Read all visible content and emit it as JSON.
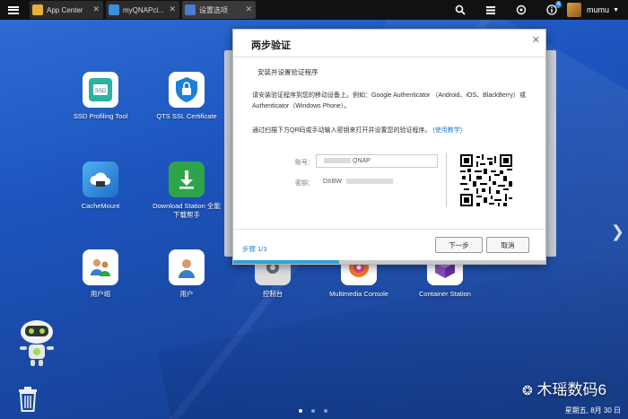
{
  "taskbar": {
    "tabs": [
      {
        "label": "App Center",
        "color": "#e8b038"
      },
      {
        "label": "myQNAPcl...",
        "color": "#3a8fe0"
      },
      {
        "label": "设置选项",
        "color": "#4a7bd0"
      }
    ],
    "notification_count": "4",
    "username": "mumu",
    "icons": [
      "search-icon",
      "tasks-icon",
      "sync-icon",
      "info-icon"
    ]
  },
  "desktop_apps": [
    {
      "label": "SSD Profiling Tool",
      "icon": "ssd-icon",
      "color": "#2bb3a0"
    },
    {
      "label": "QTS SSL Certificate",
      "icon": "lock-shield-icon",
      "color": "#1e7fd8"
    },
    {
      "label": "CacheMount",
      "icon": "cloud-icon",
      "color": "#3a9be8"
    },
    {
      "label": "Download Station 全能下载帮手",
      "icon": "download-icon",
      "color": "#2da44a"
    },
    {
      "label": "用户组",
      "icon": "user-group-icon",
      "color": "#ffffff"
    },
    {
      "label": "用户",
      "icon": "user-icon",
      "color": "#ffffff"
    },
    {
      "label": "控制台",
      "icon": "gear-icon",
      "color": "#6a6a6a"
    },
    {
      "label": "Multimedia Console",
      "icon": "multimedia-icon",
      "color": "#f07a2a"
    },
    {
      "label": "Container Station",
      "icon": "container-icon",
      "color": "#8a4ec0"
    }
  ],
  "dialog": {
    "title": "两步验证",
    "subtitle": "安装并设置验证程序",
    "paragraph": "请安装验证程序到您的移动设备上。例如：Google Authenticator （Android、iOS、BlackBerry）或Authenticator（Windows Phone）。",
    "instruction": "通过扫描下方QR码或手动输入密钥来打开并设置您的验证程序。",
    "help_link": "(使用教学)",
    "account_label": "账号：",
    "account_value": "QNAP",
    "secret_label": "密钥：",
    "secret_value": "DXBW",
    "step": "步骤 1/3",
    "progress": 0.34,
    "next_button": "下一步",
    "cancel_button": "取消"
  },
  "page_dots": 3,
  "active_dot": 0,
  "watermark": "木瑶数码6",
  "date": "星期五, 8月 30 日"
}
